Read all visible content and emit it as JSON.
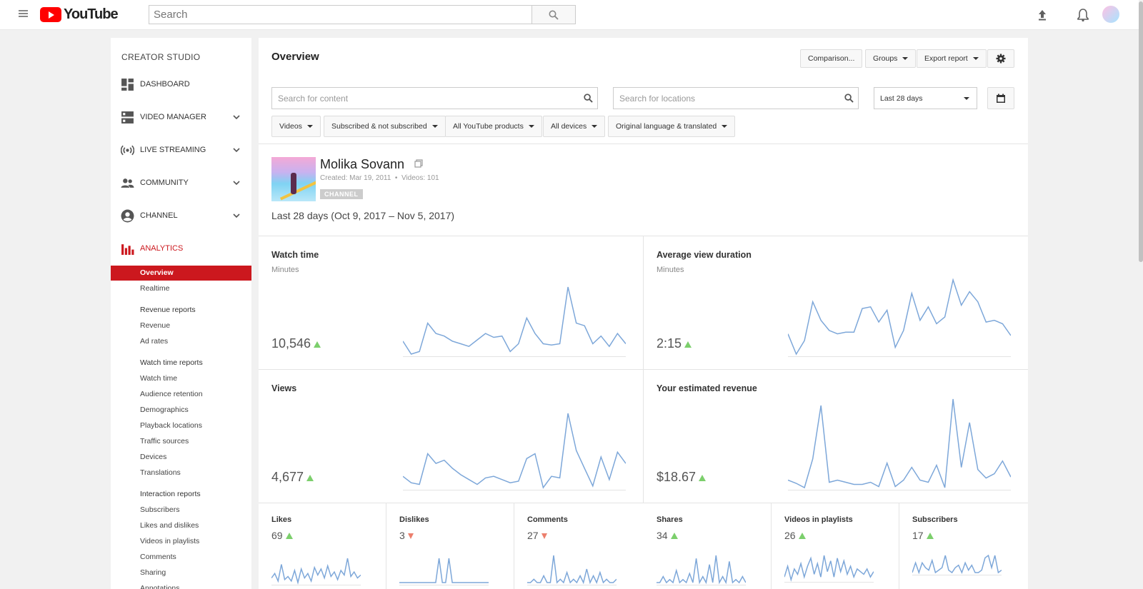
{
  "header": {
    "logo_text": "YouTube",
    "search_placeholder": "Search"
  },
  "sidebar": {
    "title": "CREATOR STUDIO",
    "main_items": [
      {
        "label": "DASHBOARD",
        "icon": "dashboard-icon",
        "has_chevron": false
      },
      {
        "label": "VIDEO MANAGER",
        "icon": "video-manager-icon",
        "has_chevron": true
      },
      {
        "label": "LIVE STREAMING",
        "icon": "live-streaming-icon",
        "has_chevron": true
      },
      {
        "label": "COMMUNITY",
        "icon": "community-icon",
        "has_chevron": true
      },
      {
        "label": "CHANNEL",
        "icon": "channel-icon",
        "has_chevron": true
      },
      {
        "label": "ANALYTICS",
        "icon": "analytics-icon",
        "active": true
      }
    ],
    "analytics": {
      "overview": "Overview",
      "realtime": "Realtime",
      "revenue_head": "Revenue reports",
      "revenue": "Revenue",
      "ad_rates": "Ad rates",
      "watch_head": "Watch time reports",
      "watch_time": "Watch time",
      "audience_retention": "Audience retention",
      "demographics": "Demographics",
      "playback_locations": "Playback locations",
      "traffic_sources": "Traffic sources",
      "devices": "Devices",
      "translations": "Translations",
      "interaction_head": "Interaction reports",
      "subscribers": "Subscribers",
      "likes_dislikes": "Likes and dislikes",
      "videos_in_playlists": "Videos in playlists",
      "comments": "Comments",
      "sharing": "Sharing",
      "annotations": "Annotations"
    }
  },
  "main": {
    "title": "Overview",
    "buttons": {
      "comparison": "Comparison...",
      "groups": "Groups",
      "export": "Export report"
    },
    "search_content_placeholder": "Search for content",
    "search_locations_placeholder": "Search for locations",
    "date_range_select": "Last 28 days",
    "filters": {
      "videos": "Videos",
      "subscribed": "Subscribed & not subscribed",
      "products": "All YouTube products",
      "devices": "All devices",
      "language": "Original language & translated"
    },
    "channel": {
      "name": "Molika Sovann",
      "created": "Created: Mar 19, 2011",
      "bullet": "•",
      "videos": "Videos: 101",
      "badge": "CHANNEL"
    },
    "range_text": "Last 28 days (Oct 9, 2017 – Nov 5, 2017)"
  },
  "chart_data": [
    {
      "type": "line",
      "title": "Watch time",
      "subtitle": "Minutes",
      "value": "10,546",
      "trend": "up",
      "values": [
        14,
        4,
        6,
        28,
        20,
        18,
        14,
        12,
        10,
        15,
        20,
        17,
        18,
        6,
        12,
        32,
        20,
        12,
        11,
        12,
        56,
        28,
        26,
        12,
        18,
        10,
        20,
        12
      ]
    },
    {
      "type": "line",
      "title": "Average view duration",
      "subtitle": "Minutes",
      "value": "2:15",
      "trend": "up",
      "values": [
        38,
        26,
        34,
        57,
        46,
        40,
        38,
        39,
        39,
        53,
        54,
        45,
        52,
        30,
        40,
        62,
        46,
        54,
        44,
        48,
        70,
        55,
        63,
        57,
        45,
        46,
        44,
        37
      ]
    },
    {
      "type": "line",
      "title": "Views",
      "subtitle": "",
      "value": "4,677",
      "trend": "up",
      "values": [
        26,
        22,
        21,
        40,
        34,
        36,
        31,
        27,
        24,
        21,
        25,
        26,
        24,
        22,
        23,
        37,
        40,
        19,
        26,
        25,
        65,
        42,
        31,
        20,
        38,
        24,
        41,
        34
      ]
    },
    {
      "type": "line",
      "title": "Your estimated revenue",
      "subtitle": "",
      "value": "$18.67",
      "trend": "up",
      "values": [
        12,
        9,
        5,
        32,
        82,
        10,
        12,
        10,
        8,
        8,
        10,
        6,
        28,
        6,
        12,
        24,
        12,
        10,
        26,
        5,
        88,
        24,
        66,
        22,
        14,
        18,
        30,
        15
      ]
    },
    {
      "type": "line",
      "title": "Likes",
      "value": "69",
      "trend": "up",
      "values": [
        6,
        9,
        4,
        15,
        5,
        7,
        4,
        11,
        3,
        12,
        6,
        9,
        4,
        13,
        8,
        12,
        6,
        14,
        7,
        10,
        5,
        11,
        8,
        19,
        7,
        10,
        6,
        8
      ]
    },
    {
      "type": "line",
      "title": "Dislikes",
      "value": "3",
      "trend": "down",
      "values": [
        0,
        0,
        0,
        0,
        0,
        0,
        0,
        0,
        0,
        0,
        0,
        0,
        1,
        0,
        0,
        1,
        0,
        0,
        0,
        0,
        0,
        0,
        0,
        0,
        0,
        0,
        0,
        0
      ]
    },
    {
      "type": "line",
      "title": "Comments",
      "value": "27",
      "trend": "down",
      "values": [
        0,
        0,
        1,
        0,
        0,
        2,
        0,
        0,
        8,
        0,
        1,
        0,
        3,
        0,
        1,
        0,
        2,
        0,
        4,
        0,
        2,
        0,
        3,
        0,
        1,
        0,
        0,
        1
      ]
    },
    {
      "type": "line",
      "title": "Shares",
      "value": "34",
      "trend": "up",
      "values": [
        0,
        0,
        2,
        0,
        1,
        0,
        4,
        0,
        1,
        0,
        3,
        0,
        8,
        0,
        2,
        0,
        6,
        0,
        9,
        0,
        2,
        0,
        7,
        0,
        1,
        0,
        2,
        0
      ]
    },
    {
      "type": "line",
      "title": "Videos in playlists",
      "value": "26",
      "trend": "up",
      "values": [
        2,
        6,
        1,
        5,
        3,
        7,
        2,
        6,
        9,
        3,
        7,
        2,
        10,
        4,
        8,
        2,
        9,
        4,
        8,
        3,
        6,
        2,
        5,
        4,
        3,
        5,
        2,
        4
      ]
    },
    {
      "type": "line",
      "title": "Subscribers",
      "value": "17",
      "trend": "up",
      "values": [
        2,
        6,
        2,
        6,
        4,
        3,
        7,
        2,
        3,
        4,
        9,
        3,
        2,
        4,
        5,
        2,
        6,
        3,
        5,
        2,
        2,
        3,
        8,
        9,
        4,
        9,
        2,
        3
      ]
    }
  ],
  "colors": {
    "accent": "#cc181e",
    "line": "#7da7d9",
    "up": "#7ccf6c",
    "down": "#ec7f6d"
  }
}
